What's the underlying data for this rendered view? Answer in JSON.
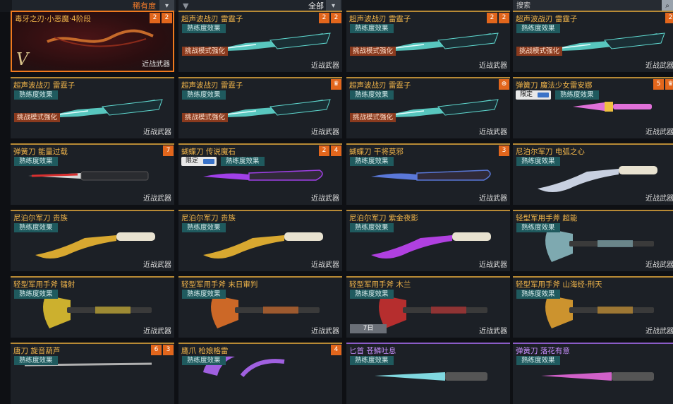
{
  "filters": {
    "rarity_label": "稀有度",
    "type_label": "全部",
    "search_label": "搜索"
  },
  "cards": [
    {
      "name": "毒牙之刃·小恶魔·4阶段",
      "tags": [],
      "category": "近战武器",
      "badges": [
        "2",
        "2"
      ],
      "frame": "sel",
      "tier": "V",
      "weapon": "serpent",
      "color": "#c56a2a"
    },
    {
      "name": "超声波战刃 雷霆子",
      "tags": [
        "熟练度效果",
        "挑战模式强化"
      ],
      "category": "近战武器",
      "badges": [
        "2",
        "2"
      ],
      "frame": "gold",
      "weapon": "sonic",
      "color": "#5fd8cf"
    },
    {
      "name": "超声波战刃 雷霆子",
      "tags": [
        "熟练度效果",
        "挑战模式强化"
      ],
      "category": "近战武器",
      "badges": [
        "2",
        "2"
      ],
      "frame": "gold",
      "weapon": "sonic",
      "color": "#5fd8cf"
    },
    {
      "name": "超声波战刃 雷霆子",
      "tags": [
        "熟练度效果",
        "挑战模式强化"
      ],
      "category": "近战武器",
      "badges": [
        "2"
      ],
      "frame": "gold",
      "weapon": "sonic",
      "color": "#5fd8cf"
    },
    {
      "name": "超声波战刃 雷霆子",
      "tags": [
        "熟练度效果",
        "挑战模式强化"
      ],
      "category": "近战武器",
      "badges": [],
      "frame": "gold",
      "weapon": "sonic",
      "color": "#5fd8cf"
    },
    {
      "name": "超声波战刃 雷霆子",
      "tags": [
        "熟练度效果",
        "挑战模式强化"
      ],
      "category": "近战武器",
      "badges": [
        "♛"
      ],
      "frame": "gold",
      "weapon": "sonic",
      "color": "#5fd8cf"
    },
    {
      "name": "超声波战刃 雷霆子",
      "tags": [
        "熟练度效果",
        "挑战模式强化"
      ],
      "category": "近战武器",
      "badges": [
        "⊕"
      ],
      "frame": "gold",
      "weapon": "sonic",
      "color": "#5fd8cf"
    },
    {
      "name": "弹簧刀 魔法少女雷安娜",
      "tags": [
        "熟练度效果"
      ],
      "limited": "限定",
      "category": "近战武器",
      "badges": [
        "5",
        "♛"
      ],
      "frame": "gold",
      "weapon": "dagger",
      "color": "#e070d8"
    },
    {
      "name": "弹簧刀 能量过载",
      "tags": [
        "熟练度效果"
      ],
      "category": "近战武器",
      "badges": [
        "7"
      ],
      "frame": "gold",
      "weapon": "spring",
      "color": "#d83030"
    },
    {
      "name": "蝴蝶刀 传说魔石",
      "tags": [
        "熟练度效果"
      ],
      "limited": "限定",
      "category": "近战武器",
      "badges": [
        "2",
        "4"
      ],
      "frame": "gold",
      "weapon": "butterfly",
      "color": "#a040e8"
    },
    {
      "name": "蝴蝶刀 干将莫邪",
      "tags": [
        "熟练度效果"
      ],
      "category": "近战武器",
      "badges": [
        "3"
      ],
      "frame": "gold",
      "weapon": "butterfly2",
      "color": "#5a78d8"
    },
    {
      "name": "尼泊尔军刀 电弧之心",
      "tags": [
        "熟练度效果"
      ],
      "category": "近战武器",
      "badges": [],
      "frame": "gold",
      "weapon": "kukri",
      "color": "#c8d0e0"
    },
    {
      "name": "尼泊尔军刀 贵族",
      "tags": [
        "熟练度效果"
      ],
      "category": "近战武器",
      "badges": [],
      "frame": "gold",
      "weapon": "kukri",
      "color": "#d8a830"
    },
    {
      "name": "尼泊尔军刀 贵族",
      "tags": [
        "熟练度效果"
      ],
      "category": "近战武器",
      "badges": [],
      "frame": "gold",
      "weapon": "kukri",
      "color": "#d8a830"
    },
    {
      "name": "尼泊尔军刀 紫金夜影",
      "tags": [
        "熟练度效果"
      ],
      "category": "近战武器",
      "badges": [],
      "frame": "gold",
      "weapon": "kukri",
      "color": "#b040e0"
    },
    {
      "name": "轻型军用手斧 超能",
      "tags": [
        "熟练度效果"
      ],
      "category": "近战武器",
      "badges": [],
      "frame": "gold",
      "weapon": "axe",
      "color": "#8ab8c0"
    },
    {
      "name": "轻型军用手斧 镭射",
      "tags": [
        "熟练度效果"
      ],
      "category": "近战武器",
      "badges": [],
      "frame": "gold",
      "weapon": "axe",
      "color": "#e0c030"
    },
    {
      "name": "轻型军用手斧 末日审判",
      "tags": [
        "熟练度效果"
      ],
      "category": "近战武器",
      "badges": [],
      "frame": "gold",
      "weapon": "axe",
      "color": "#e07028"
    },
    {
      "name": "轻型军用手斧 木兰",
      "tags": [
        "熟练度效果"
      ],
      "category": "近战武器",
      "badges": [],
      "frame": "gold",
      "weapon": "axe",
      "color": "#c83030",
      "timer": "7日"
    },
    {
      "name": "轻型军用手斧 山海经-刑天",
      "tags": [
        "熟练度效果"
      ],
      "category": "近战武器",
      "badges": [],
      "frame": "gold",
      "weapon": "axe",
      "color": "#e0a030"
    },
    {
      "name": "唐刀 旋音葫芦",
      "tags": [
        "熟练度效果"
      ],
      "category": "",
      "badges": [
        "6",
        "3"
      ],
      "frame": "gold",
      "weapon": "katana",
      "color": "#b0b0b0"
    },
    {
      "name": "鹰爪 枪娘格雷",
      "tags": [
        "熟练度效果"
      ],
      "category": "",
      "badges": [
        "4"
      ],
      "frame": "gold",
      "weapon": "claw",
      "color": "#a060e0"
    },
    {
      "name": "匕首 苍鳞吐息",
      "tags": [
        "熟练度效果"
      ],
      "category": "",
      "badges": [],
      "frame": "purple",
      "weapon": "blade",
      "color": "#80d8e0"
    },
    {
      "name": "弹簧刀 落花有意",
      "tags": [
        "熟练度效果"
      ],
      "category": "",
      "badges": [],
      "frame": "purple",
      "weapon": "blade",
      "color": "#d060c8"
    }
  ]
}
